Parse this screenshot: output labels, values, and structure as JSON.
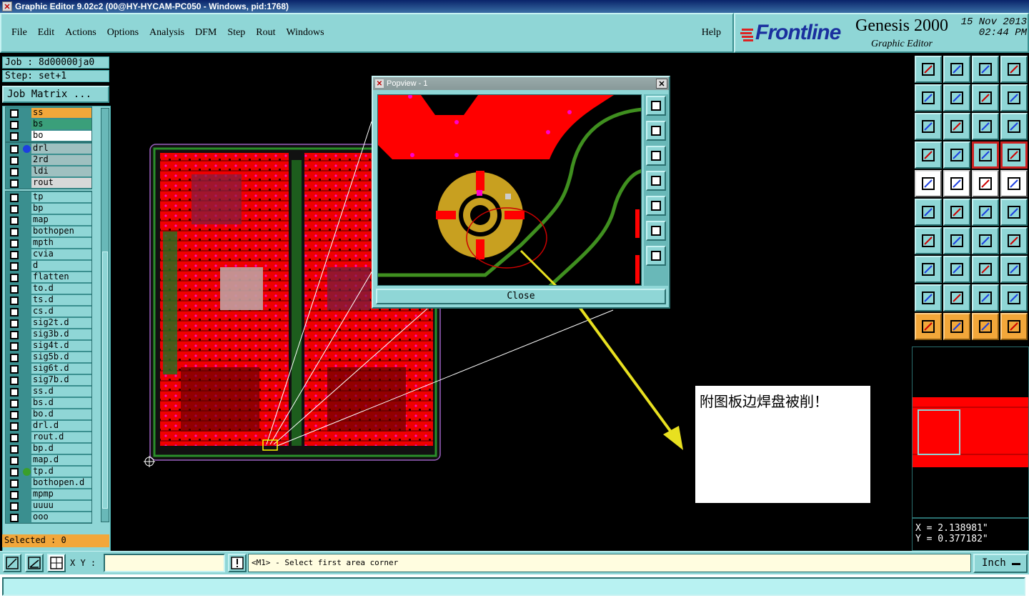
{
  "window": {
    "title": "Graphic Editor 9.02c2 (00@HY-HYCAM-PC050 - Windows, pid:1768)"
  },
  "menu": {
    "items": [
      "File",
      "Edit",
      "Actions",
      "Options",
      "Analysis",
      "DFM",
      "Step",
      "Rout",
      "Windows"
    ],
    "help": "Help"
  },
  "logo": {
    "brand": "Frontline",
    "product": "Genesis 2000",
    "subtitle": "Graphic Editor",
    "date": "15 Nov 2013",
    "time": "02:44 PM"
  },
  "job": {
    "job_label": "Job : 8d00000ja0",
    "step_label": "Step: set+1",
    "matrix_button": "Job Matrix ..."
  },
  "layers": {
    "group1": [
      {
        "name": "ss",
        "color": "#f2a73a",
        "dot": ""
      },
      {
        "name": "bs",
        "color": "#3a9f7a",
        "dot": ""
      },
      {
        "name": "bo",
        "color": "#ffffff",
        "dot": ""
      }
    ],
    "group2": [
      {
        "name": "drl",
        "color": "#9fc0c0",
        "dot": "#1d3fe0"
      },
      {
        "name": "2rd",
        "color": "#9fc0c0",
        "dot": ""
      },
      {
        "name": "ldi",
        "color": "#9fc0c0",
        "dot": ""
      },
      {
        "name": "rout",
        "color": "#d8d8d8",
        "dot": ""
      }
    ],
    "group3": [
      {
        "name": "tp",
        "dot": ""
      },
      {
        "name": "bp",
        "dot": ""
      },
      {
        "name": "map",
        "dot": ""
      },
      {
        "name": "bothopen",
        "dot": ""
      },
      {
        "name": "mpth",
        "dot": ""
      },
      {
        "name": "cvia",
        "dot": ""
      },
      {
        "name": "d",
        "dot": ""
      },
      {
        "name": "flatten",
        "dot": ""
      },
      {
        "name": "to.d",
        "dot": ""
      },
      {
        "name": "ts.d",
        "dot": ""
      },
      {
        "name": "cs.d",
        "dot": ""
      },
      {
        "name": "sig2t.d",
        "dot": ""
      },
      {
        "name": "sig3b.d",
        "dot": ""
      },
      {
        "name": "sig4t.d",
        "dot": ""
      },
      {
        "name": "sig5b.d",
        "dot": ""
      },
      {
        "name": "sig6t.d",
        "dot": ""
      },
      {
        "name": "sig7b.d",
        "dot": ""
      },
      {
        "name": "ss.d",
        "dot": ""
      },
      {
        "name": "bs.d",
        "dot": ""
      },
      {
        "name": "bo.d",
        "dot": ""
      },
      {
        "name": "drl.d",
        "dot": ""
      },
      {
        "name": "rout.d",
        "dot": ""
      },
      {
        "name": "bp.d",
        "dot": ""
      },
      {
        "name": "map.d",
        "dot": ""
      },
      {
        "name": "tp.d",
        "dot": "#3a9f2a"
      },
      {
        "name": "bothopen.d",
        "dot": ""
      },
      {
        "name": "mpmp",
        "dot": ""
      },
      {
        "name": "uuuu",
        "dot": ""
      },
      {
        "name": "ooo",
        "dot": ""
      }
    ],
    "selected_label": "Selected : 0"
  },
  "popview": {
    "title": "Popview - 1",
    "close_label": "Close"
  },
  "note": {
    "text": "附图板边焊盘被削！"
  },
  "coords": {
    "x": "X = 2.138981\"",
    "y": "Y = 0.377182\""
  },
  "status": {
    "xy_label": "X Y :",
    "xy_value": "",
    "message": "<M1> - Select first area corner",
    "unit": "Inch"
  },
  "colors": {
    "panel": "#8fd6d6",
    "copper": "#ff0000",
    "trace": "#3f8f1f",
    "pad": "#c8a020",
    "arrow": "#e8e020"
  }
}
